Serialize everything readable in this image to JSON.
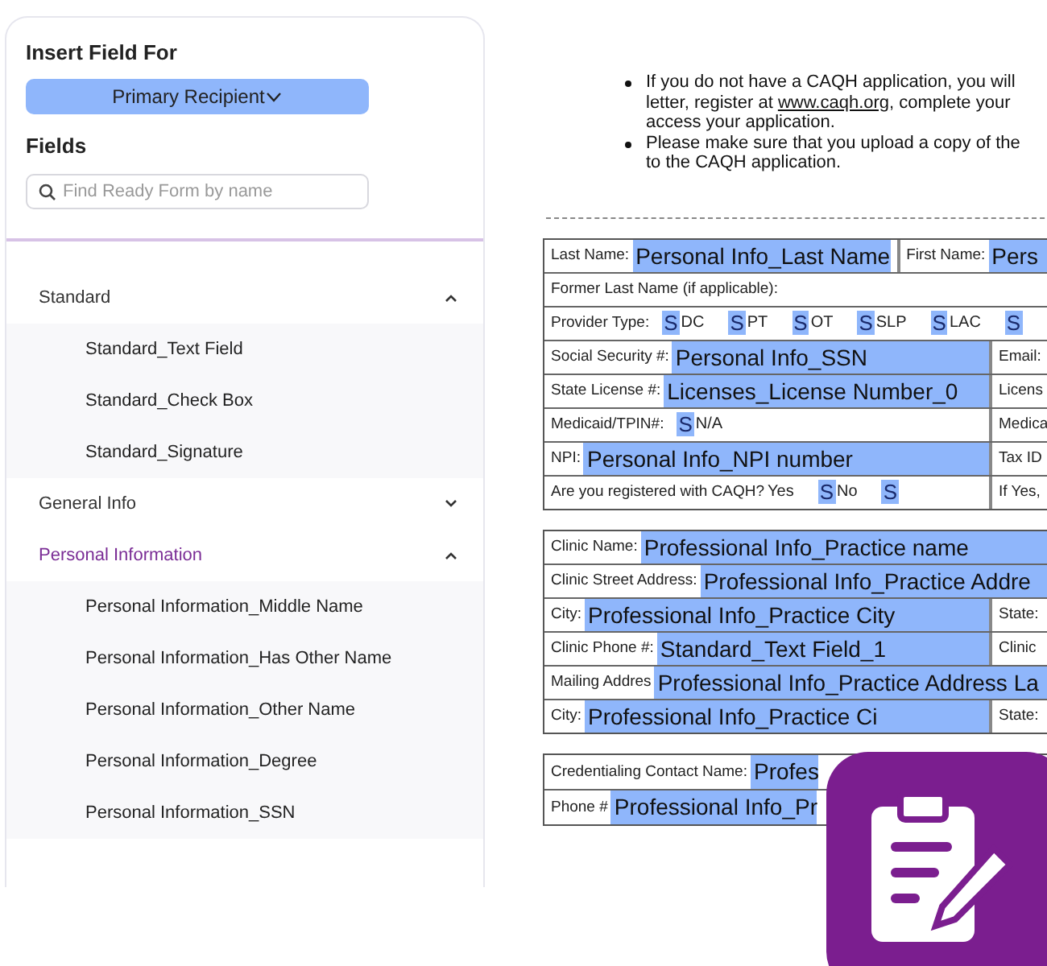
{
  "sidebar": {
    "heading": "Insert Field For",
    "recipient_button": "Primary Recipient",
    "fields_heading": "Fields",
    "search": {
      "placeholder": "Find Ready Form by name"
    },
    "groups": [
      {
        "label": "Standard",
        "expanded": true,
        "selected": false,
        "children": [
          "Standard_Text Field",
          "Standard_Check Box",
          "Standard_Signature"
        ]
      },
      {
        "label": "General Info",
        "expanded": false,
        "selected": false
      },
      {
        "label": "Personal Information",
        "expanded": true,
        "selected": true,
        "children": [
          "Personal Information_Middle Name",
          "Personal Information_Has Other Name",
          "Personal Information_Other Name",
          "Personal Information_Degree",
          "Personal Information_SSN"
        ]
      }
    ]
  },
  "document": {
    "bullets": [
      [
        [
          {
            "kind": "text",
            "text": "If you do not have a CAQH application, you will"
          }
        ],
        [
          {
            "kind": "text",
            "text": "letter, register at "
          },
          {
            "kind": "link",
            "text": "www.caqh.org"
          },
          {
            "kind": "text",
            "text": ", complete your"
          }
        ],
        [
          {
            "kind": "text",
            "text": "access your application."
          }
        ]
      ],
      [
        [
          {
            "kind": "text",
            "text": "Please make sure that you upload a copy of the"
          }
        ],
        [
          {
            "kind": "text",
            "text": "to the CAQH application."
          }
        ]
      ]
    ],
    "tables": [
      [
        [
          {
            "label": "Last Name:",
            "field": "Personal Info_Last Name"
          },
          {
            "label": "First Name:",
            "field": "Pers"
          }
        ],
        [
          {
            "label": "Former Last Name (if applicable):"
          }
        ],
        [
          {
            "label": "Provider Type:",
            "options": [
              {
                "kind": "mark",
                "text": "S"
              },
              {
                "kind": "text",
                "text": "DC"
              },
              {
                "kind": "mark",
                "text": "S"
              },
              {
                "kind": "text",
                "text": "PT"
              },
              {
                "kind": "mark",
                "text": "S"
              },
              {
                "kind": "text",
                "text": "OT"
              },
              {
                "kind": "mark",
                "text": "S"
              },
              {
                "kind": "text",
                "text": "SLP"
              },
              {
                "kind": "mark",
                "text": "S"
              },
              {
                "kind": "text",
                "text": "LAC"
              },
              {
                "kind": "mark",
                "text": "S"
              }
            ]
          }
        ],
        [
          {
            "label": "Social Security #:",
            "field": "Personal Info_SSN"
          },
          {
            "label": "Email:"
          }
        ],
        [
          {
            "label": "State License #:",
            "field": "Licenses_License Number_0"
          },
          {
            "label": "Licens"
          }
        ],
        [
          {
            "label": "Medicaid/TPIN#:",
            "options": [
              {
                "kind": "mark",
                "text": "S"
              },
              {
                "kind": "text",
                "text": "N/A"
              }
            ]
          },
          {
            "label": "Medica"
          }
        ],
        [
          {
            "label": "NPI:",
            "field": "Personal Info_NPI number"
          },
          {
            "label": "Tax ID"
          }
        ],
        [
          {
            "label": "Are you registered with CAQH?",
            "options": [
              {
                "kind": "text",
                "text": "Yes"
              },
              {
                "kind": "mark",
                "text": "S"
              },
              {
                "kind": "text",
                "text": "No"
              },
              {
                "kind": "mark",
                "text": "S"
              }
            ]
          },
          {
            "label": "If Yes,"
          }
        ]
      ],
      [
        [
          {
            "label": "Clinic Name:",
            "field": "Professional Info_Practice name"
          }
        ],
        [
          {
            "label": "Clinic Street Address:",
            "field": "Professional Info_Practice Addre"
          }
        ],
        [
          {
            "label": "City:",
            "field": "Professional Info_Practice City"
          },
          {
            "label": "State:"
          }
        ],
        [
          {
            "label": "Clinic Phone #:",
            "field": "Standard_Text Field_1"
          },
          {
            "label": "Clinic"
          }
        ],
        [
          {
            "label": "Mailing Addres",
            "field": "Professional Info_Practice Address La"
          }
        ],
        [
          {
            "label": "City:",
            "field": "Professional Info_Practice Ci"
          },
          {
            "label": "State:"
          }
        ]
      ],
      [
        [
          {
            "label": "Credentialing Contact Name:",
            "field": "Profes"
          }
        ],
        [
          {
            "label": "Phone #",
            "field": "Professional Info_Pr"
          }
        ]
      ]
    ]
  }
}
